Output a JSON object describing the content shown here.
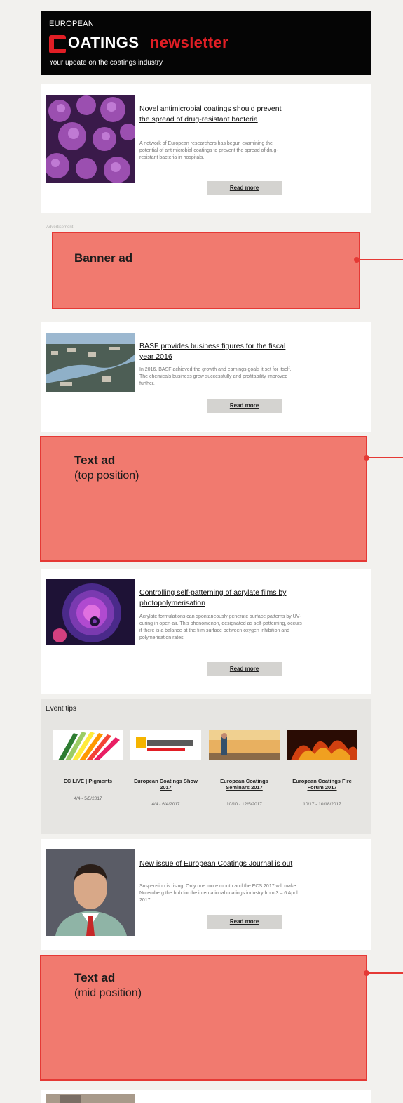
{
  "header": {
    "top_label": "EUROPEAN",
    "brand_rest": "OATINGS",
    "brand_highlight": "newsletter",
    "tagline": "Your update on the coatings industry",
    "colors": {
      "background": "#050505",
      "accent": "#e11e25"
    }
  },
  "articles": [
    {
      "title": "Novel antimicrobial coatings should prevent the spread of drug-resistant bacteria",
      "text": "A network of European researchers has begun examining the potential of antimicrobial coatings to prevent the spread of drug-resistant bacteria in hospitals.",
      "read_more": "Read more",
      "image": "bacteria-photo"
    },
    {
      "title": "BASF provides business figures for the fiscal year 2016",
      "text": "In 2016, BASF achieved the growth and earnings goals it set for itself. The chemicals business grew successfully and profitability improved further.",
      "read_more": "Read more",
      "image": "river-aerial-photo"
    },
    {
      "title": "Controlling self-patterning of acrylate films by photopolymerisation",
      "text": "Acrylate formulations can spontaneously generate surface patterns by UV-curing in open-air. This phenomenon, designated as self-patterning, occurs if there is a balance at the film surface between oxygen inhibition and polymerisation rates.",
      "read_more": "Read more",
      "image": "purple-pattern-photo"
    },
    {
      "title": "New issue of European Coatings Journal is out",
      "text": "Suspension is rising. Only one more month and the ECS 2017 will make Nuremberg the hub for the international coatings industry from 3 – 6 April 2017.",
      "read_more": "Read more",
      "image": "editor-portrait-photo"
    }
  ],
  "ads": {
    "advertisement_label": "Advertisement",
    "banner": {
      "title": "Banner ad"
    },
    "text_top": {
      "title": "Text ad",
      "subtitle": "(top position)"
    },
    "text_mid": {
      "title": "Text ad",
      "subtitle": "(mid position)"
    },
    "colors": {
      "fill": "#f17a6f",
      "border": "#e53935"
    }
  },
  "events": {
    "heading": "Event tips",
    "items": [
      {
        "title": "EC LIVE | Pigments",
        "date": "4/4 - 5/5/2017",
        "image": "color-swatches"
      },
      {
        "title": "European Coatings Show 2017",
        "date": "4/4 - 6/4/2017",
        "image": "ecs-logo-banner"
      },
      {
        "title": "European Coatings Seminars 2017",
        "date": "10/10 - 12/5/2017",
        "image": "seminar-photo"
      },
      {
        "title": "European Coatings Fire Forum 2017",
        "date": "10/17 - 10/18/2017",
        "image": "fire-photo"
      }
    ]
  }
}
